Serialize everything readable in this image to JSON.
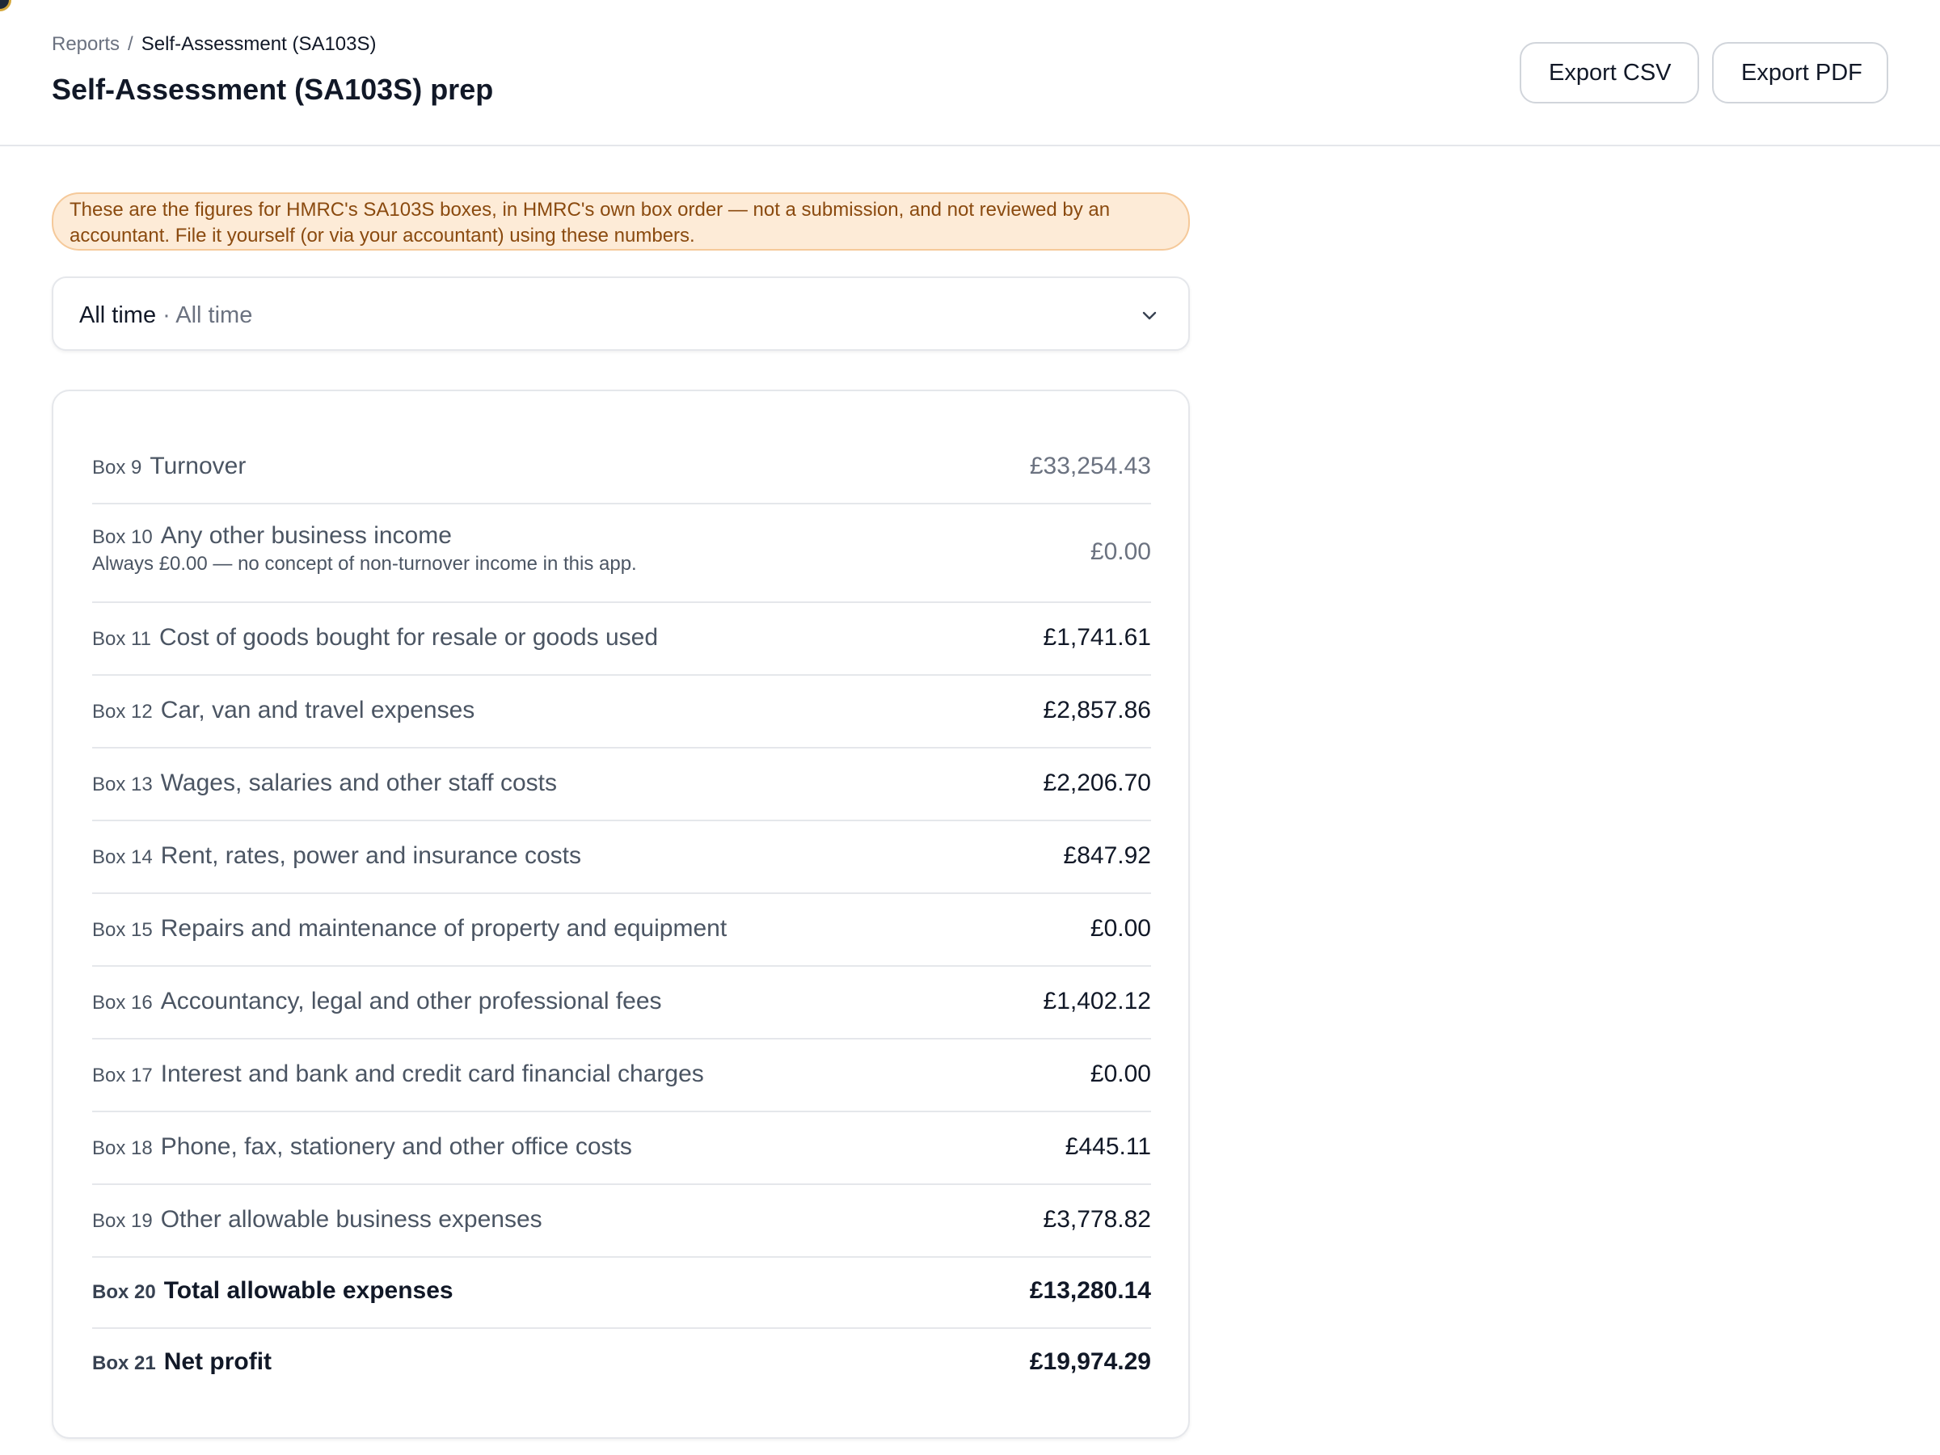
{
  "breadcrumb": {
    "parent": "Reports",
    "separator": "/",
    "current": "Self-Assessment (SA103S)"
  },
  "page": {
    "title": "Self-Assessment (SA103S) prep"
  },
  "actions": {
    "export_csv": "Export CSV",
    "export_pdf": "Export PDF"
  },
  "notice": {
    "text": "These are the figures for HMRC's SA103S boxes, in HMRC's own box order — not a submission, and not reviewed by an accountant. File it yourself (or via your accountant) using these numbers."
  },
  "period": {
    "label": "All time",
    "separator": " · ",
    "sublabel": "All time",
    "icon": "chevron-down-icon"
  },
  "colors": {
    "notice_bg": "#fdebd7",
    "notice_border": "#f5c99a",
    "notice_text": "#8a4a0f",
    "divider": "#e5e7eb"
  },
  "boxes": [
    {
      "box": "Box 9",
      "label": "Turnover",
      "value": "£33,254.43",
      "muted": true
    },
    {
      "box": "Box 10",
      "label": "Any other business income",
      "note": "Always £0.00 — no concept of non-turnover income in this app.",
      "value": "£0.00",
      "muted": true
    },
    {
      "box": "Box 11",
      "label": "Cost of goods bought for resale or goods used",
      "value": "£1,741.61"
    },
    {
      "box": "Box 12",
      "label": "Car, van and travel expenses",
      "value": "£2,857.86"
    },
    {
      "box": "Box 13",
      "label": "Wages, salaries and other staff costs",
      "value": "£2,206.70"
    },
    {
      "box": "Box 14",
      "label": "Rent, rates, power and insurance costs",
      "value": "£847.92"
    },
    {
      "box": "Box 15",
      "label": "Repairs and maintenance of property and equipment",
      "value": "£0.00"
    },
    {
      "box": "Box 16",
      "label": "Accountancy, legal and other professional fees",
      "value": "£1,402.12"
    },
    {
      "box": "Box 17",
      "label": "Interest and bank and credit card financial charges",
      "value": "£0.00"
    },
    {
      "box": "Box 18",
      "label": "Phone, fax, stationery and other office costs",
      "value": "£445.11"
    },
    {
      "box": "Box 19",
      "label": "Other allowable business expenses",
      "value": "£3,778.82"
    },
    {
      "box": "Box 20",
      "label": "Total allowable expenses",
      "value": "£13,280.14",
      "total": true
    },
    {
      "box": "Box 21",
      "label": "Net profit",
      "value": "£19,974.29",
      "total": true
    }
  ]
}
